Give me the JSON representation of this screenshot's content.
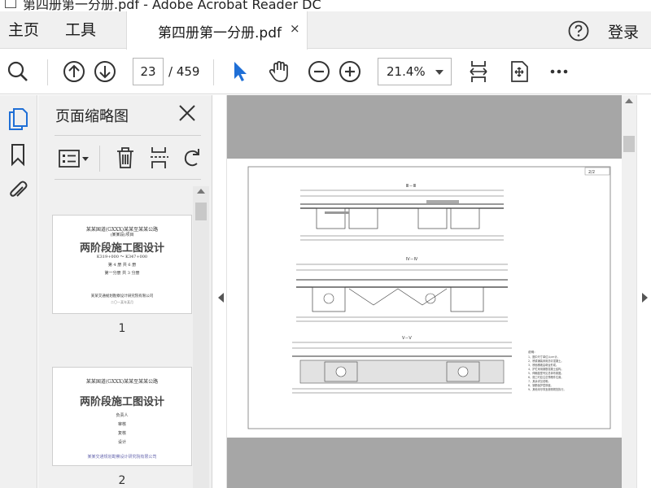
{
  "window": {
    "title": "第四册第一分册.pdf - Adobe Acrobat Reader DC"
  },
  "menu": {
    "home": "主页",
    "tools": "工具",
    "login": "登录"
  },
  "tab": {
    "title": "第四册第一分册.pdf",
    "close": "×"
  },
  "toolbar": {
    "page_current": "23",
    "page_total": "/ 459",
    "zoom": "21.4%"
  },
  "thumbnails": {
    "title": "页面缩略图",
    "pages": [
      {
        "number": "1",
        "title": "两阶段施工图设计",
        "lines": [
          "某某国道(GXXX)某某至某某公路",
          "(某某段)项目",
          "K319+000 ～ K347+000",
          "第 4 册 共 6 册",
          "第一分册 共 3 分册",
          "某某交通规划勘察设计研究院有限公司",
          "二〇一某年某月"
        ]
      },
      {
        "number": "2",
        "title": "两阶段施工图设计",
        "lines": [
          "某某国道(GXXX)某某至某某公路",
          "负责人",
          "审核",
          "复核",
          "设计",
          "某某交通规划勘察设计研究院有限公司"
        ]
      }
    ]
  },
  "drawing": {
    "page_tag": "2/2",
    "sections": [
      "Ⅲ－Ⅲ",
      "Ⅳ－Ⅳ",
      "Ⅴ－Ⅴ"
    ],
    "notes_title": "说明：",
    "notes": [
      "1、图中尺寸单位以cm计。",
      "2、桥梁铺装采用沥青混凝土。",
      "3、桥面横坡由墩台形成。",
      "4、护栏采用钢筋混凝土结构。",
      "5、伸缩缝型号见总体布置图。",
      "6、施工时应注意预埋件位置。",
      "7、其余详见说明。",
      "8、钢筋保护层厚度。",
      "9、其他未尽事宜参照规范执行。"
    ]
  },
  "icons": {
    "help": "help-circle-icon",
    "search": "search-icon",
    "prev": "arrow-up-circle-icon",
    "next": "arrow-down-circle-icon",
    "select": "cursor-icon",
    "hand": "hand-icon",
    "zoom_out": "zoom-out-icon",
    "zoom_in": "zoom-in-icon",
    "fit_page": "fit-page-icon",
    "full_screen": "full-screen-icon",
    "more": "more-icon"
  }
}
